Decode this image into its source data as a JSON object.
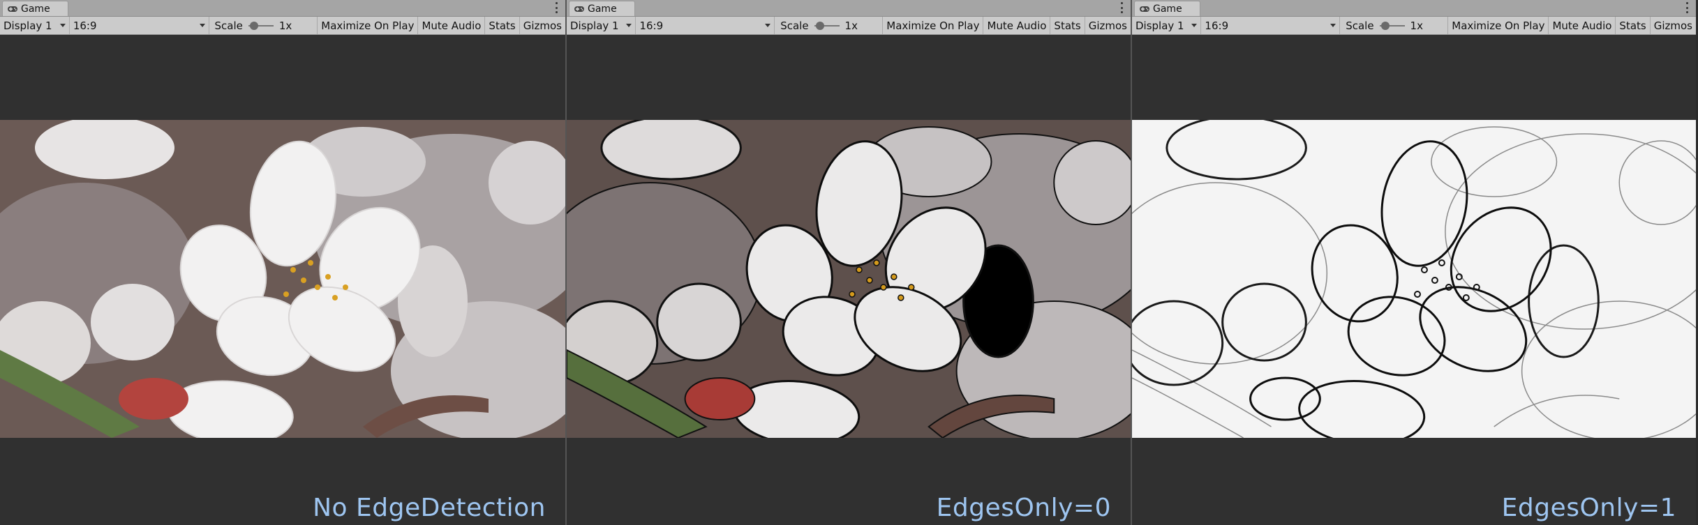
{
  "panels": [
    {
      "tab_title": "Game",
      "toolbar": {
        "display": "Display 1",
        "aspect": "16:9",
        "scale_label": "Scale",
        "scale_value": "1x",
        "maximize": "Maximize On Play",
        "mute": "Mute Audio",
        "stats": "Stats",
        "gizmos": "Gizmos"
      },
      "caption": "No EdgeDetection",
      "mode": "color"
    },
    {
      "tab_title": "Game",
      "toolbar": {
        "display": "Display 1",
        "aspect": "16:9",
        "scale_label": "Scale",
        "scale_value": "1x",
        "maximize": "Maximize On Play",
        "mute": "Mute Audio",
        "stats": "Stats",
        "gizmos": "Gizmos"
      },
      "caption": "EdgesOnly=0",
      "mode": "edges-on-color"
    },
    {
      "tab_title": "Game",
      "toolbar": {
        "display": "Display 1",
        "aspect": "16:9",
        "scale_label": "Scale",
        "scale_value": "1x",
        "maximize": "Maximize On Play",
        "mute": "Mute Audio",
        "stats": "Stats",
        "gizmos": "Gizmos"
      },
      "caption": "EdgesOnly=1",
      "mode": "edges-only"
    }
  ],
  "colors": {
    "caption": "#9ec5f0",
    "editor_background": "#303030",
    "toolbar": "#cbcbcb"
  },
  "icons": {
    "tab": "gamepad-icon",
    "menu": "kebab-menu-icon"
  }
}
